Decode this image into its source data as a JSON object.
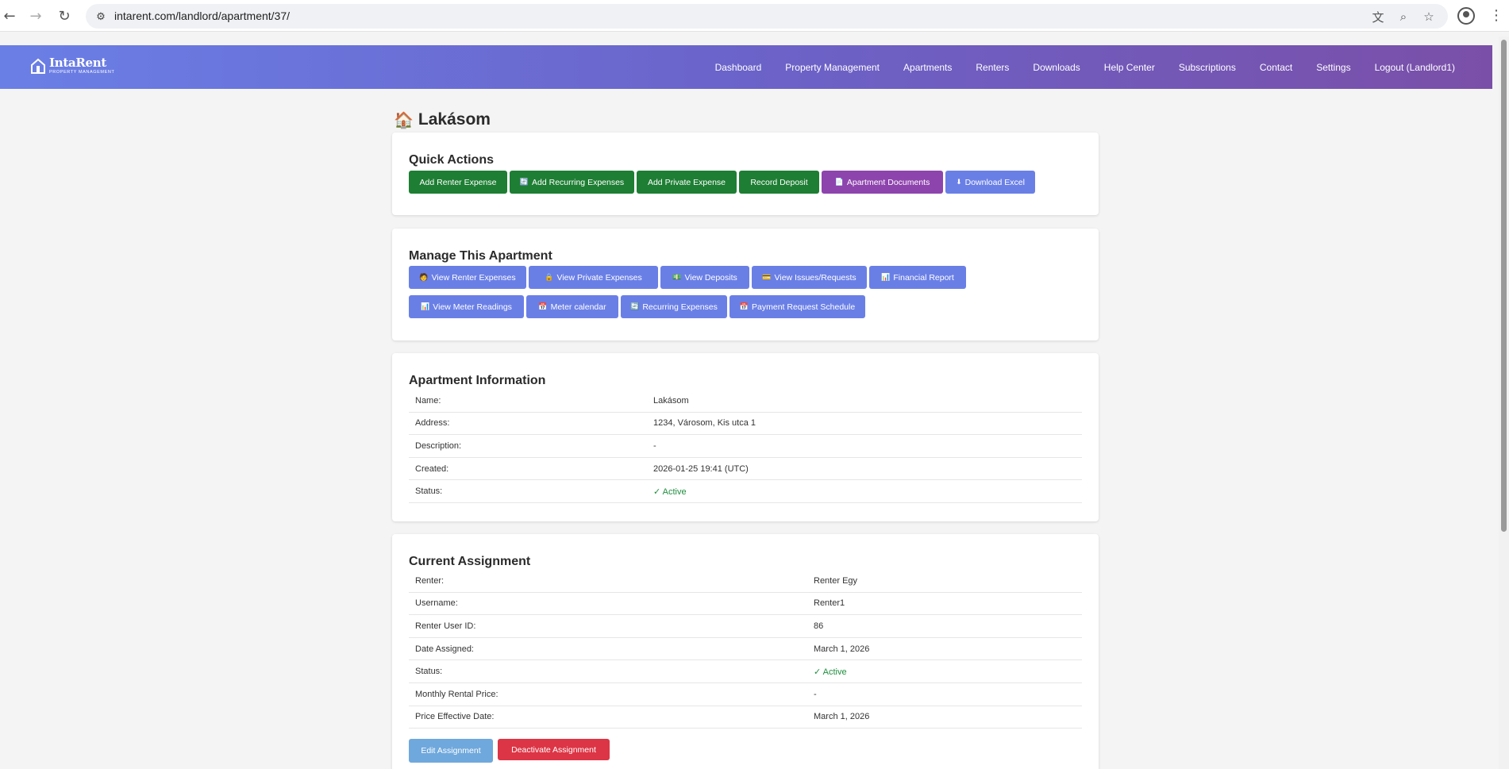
{
  "browser": {
    "url": "intarent.com/landlord/apartment/37/"
  },
  "header": {
    "logo_name": "IntaRent",
    "logo_sub": "PROPERTY MANAGEMENT",
    "nav": [
      "Dashboard",
      "Property Management",
      "Apartments",
      "Renters",
      "Downloads",
      "Help Center",
      "Subscriptions",
      "Contact",
      "Settings",
      "Logout (Landlord1)"
    ]
  },
  "page": {
    "title": "Lakásom"
  },
  "quick_actions": {
    "title": "Quick Actions",
    "add_renter_expense": "Add Renter Expense",
    "add_recurring_expenses": "Add Recurring Expenses",
    "add_private_expense": "Add Private Expense",
    "record_deposit": "Record Deposit",
    "apartment_documents": "Apartment Documents",
    "download_excel": "Download Excel"
  },
  "manage": {
    "title": "Manage This Apartment",
    "view_renter_expenses": "View Renter Expenses",
    "view_private_expenses": "View Private Expenses",
    "view_deposits": "View Deposits",
    "view_issues": "View Issues/Requests",
    "financial_report": "Financial Report",
    "view_meter_readings": "View Meter Readings",
    "meter_calendar": "Meter calendar",
    "recurring_expenses": "Recurring Expenses",
    "payment_request_schedule": "Payment Request Schedule"
  },
  "apartment_info": {
    "title": "Apartment Information",
    "rows": [
      {
        "label": "Name:",
        "value": "Lakásom"
      },
      {
        "label": "Address:",
        "value": "1234, Városom, Kis utca 1"
      },
      {
        "label": "Description:",
        "value": "-"
      },
      {
        "label": "Created:",
        "value": "2026-01-25 19:41 (UTC)"
      },
      {
        "label": "Status:",
        "value": "✓ Active"
      }
    ]
  },
  "assignment": {
    "title": "Current Assignment",
    "rows": [
      {
        "label": "Renter:",
        "value": "Renter Egy"
      },
      {
        "label": "Username:",
        "value": "Renter1"
      },
      {
        "label": "Renter User ID:",
        "value": "86"
      },
      {
        "label": "Date Assigned:",
        "value": "March 1, 2026"
      },
      {
        "label": "Status:",
        "value": "✓ Active"
      },
      {
        "label": "Monthly Rental Price:",
        "value": "-"
      },
      {
        "label": "Price Effective Date:",
        "value": "March 1, 2026"
      }
    ],
    "edit_label": "Edit Assignment",
    "deactivate_label": "Deactivate Assignment"
  },
  "colors": {
    "green": "#1e7e34",
    "purple": "#8e44ad",
    "blue": "#6a7fe6",
    "red": "#dc3545",
    "active": "#1e8e3e"
  }
}
